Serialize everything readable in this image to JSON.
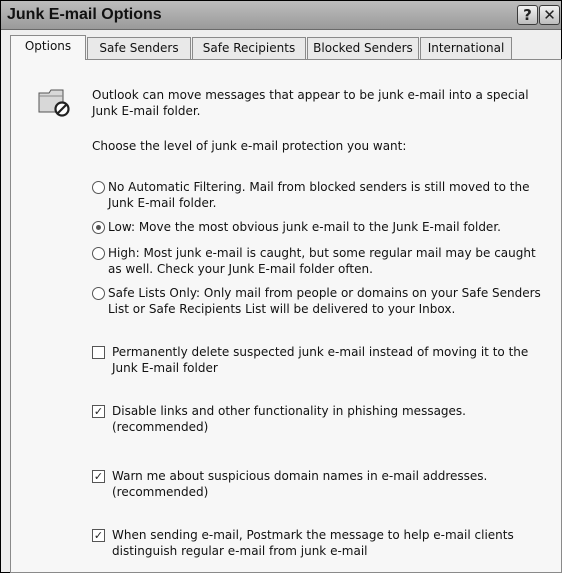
{
  "window": {
    "title": "Junk E-mail Options",
    "help_glyph": "?",
    "close_glyph": "✕"
  },
  "tabs": [
    {
      "label": "Options",
      "active": true
    },
    {
      "label": "Safe Senders",
      "active": false
    },
    {
      "label": "Safe Recipients",
      "active": false
    },
    {
      "label": "Blocked Senders",
      "active": false
    },
    {
      "label": "International",
      "active": false
    }
  ],
  "intro": {
    "icon": "junk-folder-icon",
    "text": "Outlook can move messages that appear to be junk e-mail into a special Junk E-mail folder."
  },
  "protection": {
    "prompt": "Choose the level of junk e-mail protection you want:",
    "options": [
      {
        "label": "No Automatic Filtering. Mail from blocked senders is still moved to the Junk E-mail folder.",
        "selected": false
      },
      {
        "label": "Low: Move the most obvious junk e-mail to the Junk E-mail folder.",
        "selected": true
      },
      {
        "label": "High: Most junk e-mail is caught, but some regular mail may be caught as well. Check your Junk E-mail folder often.",
        "selected": false
      },
      {
        "label": "Safe Lists Only: Only mail from people or domains on your Safe Senders List or Safe Recipients List will be delivered to your Inbox.",
        "selected": false
      }
    ]
  },
  "checkboxes": [
    {
      "label": "Permanently delete suspected junk e-mail instead of moving it to the Junk E-mail folder",
      "checked": false
    },
    {
      "label": "Disable links and other functionality in phishing messages. (recommended)",
      "checked": true
    },
    {
      "label": "Warn me about suspicious domain names in e-mail addresses. (recommended)",
      "checked": true
    },
    {
      "label": "When sending e-mail, Postmark the message to help e-mail clients distinguish regular e-mail from junk e-mail",
      "checked": true
    }
  ],
  "check_glyph": "✓"
}
